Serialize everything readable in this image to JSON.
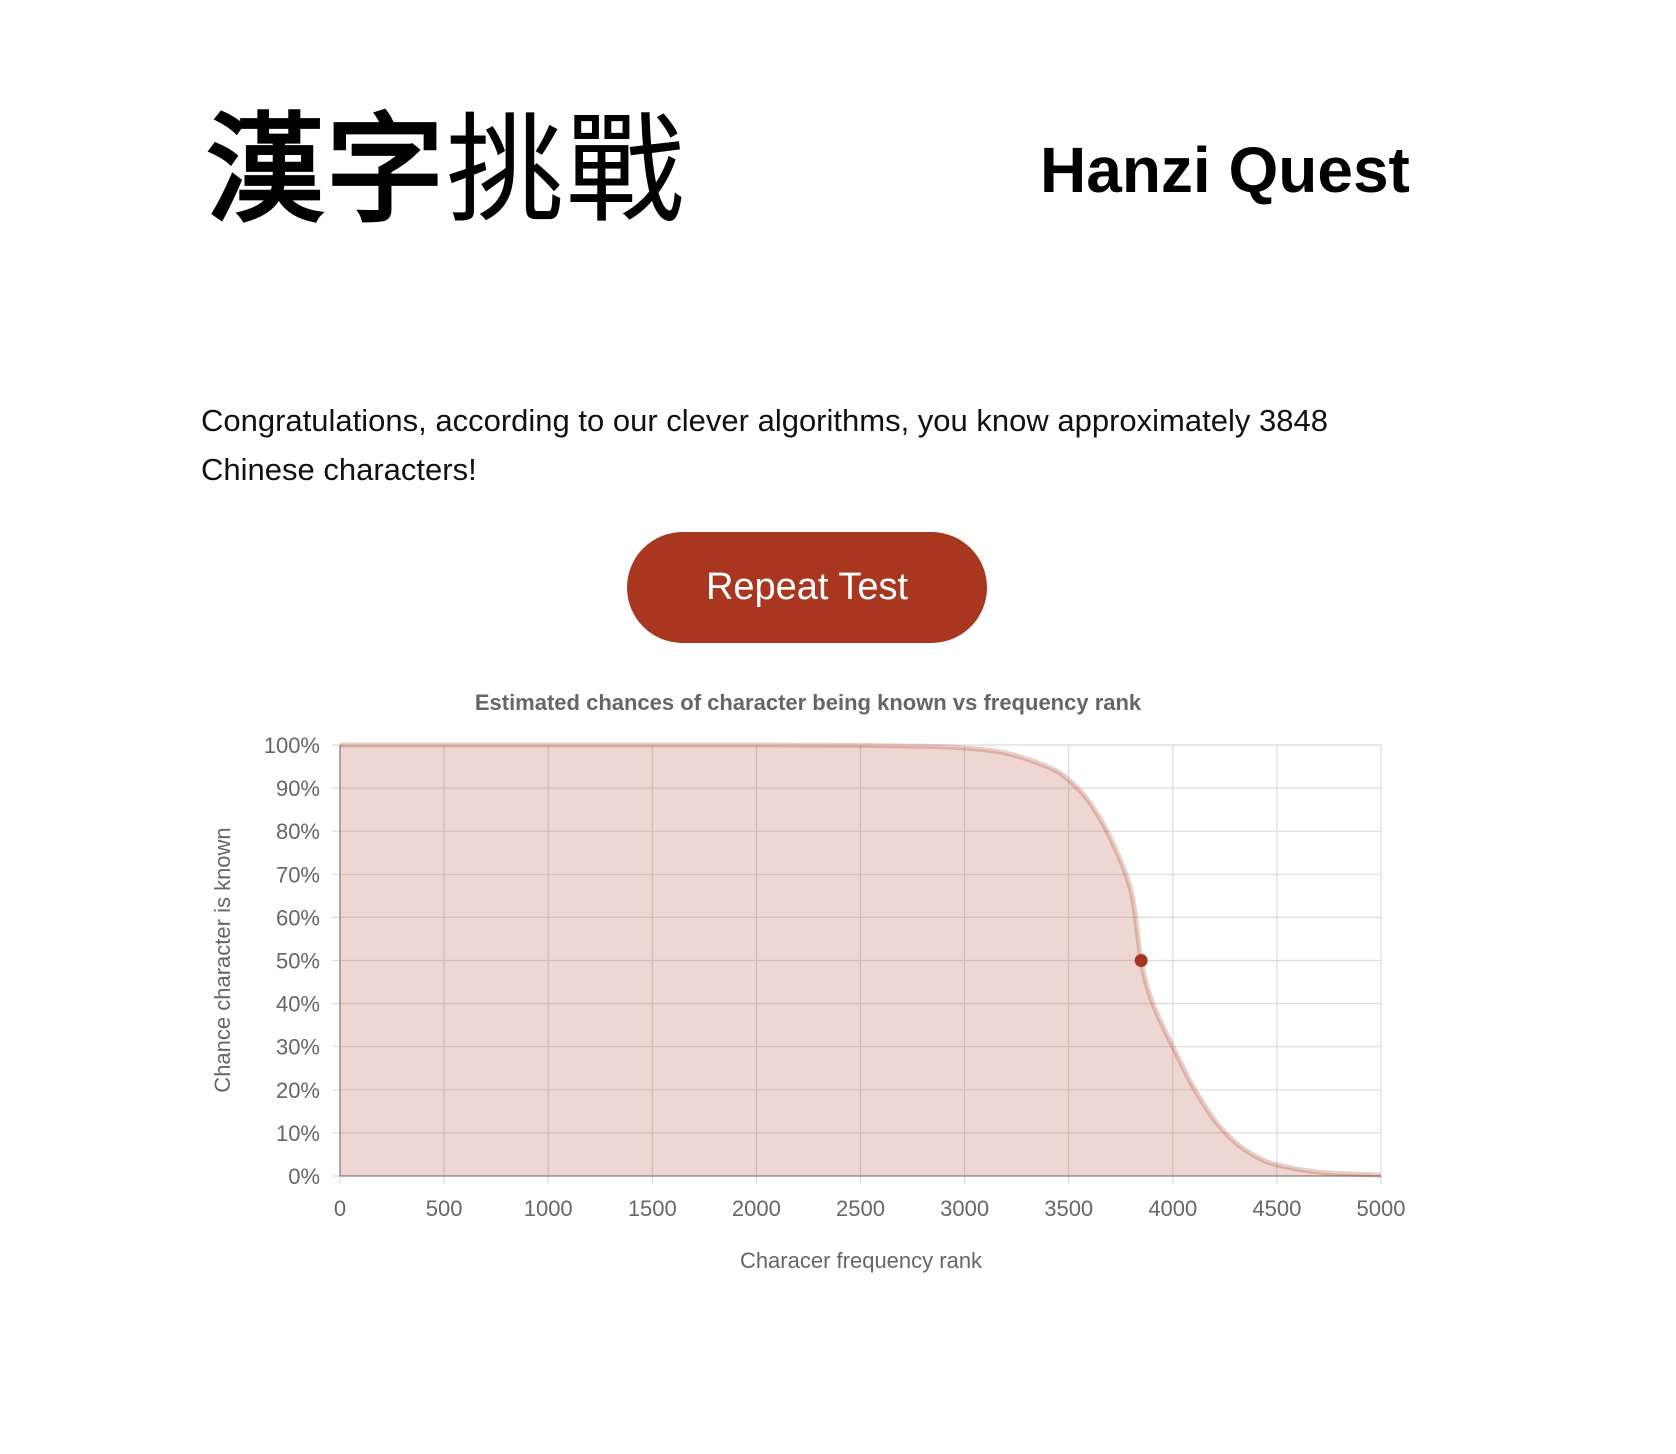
{
  "header": {
    "logo_chars": [
      "漢",
      "字",
      "挑",
      "戰"
    ],
    "site_title": "Hanzi Quest"
  },
  "result": {
    "message": "Congratulations, according to our clever algorithms, you know approximately 3848 Chinese characters!"
  },
  "actions": {
    "repeat_label": "Repeat Test"
  },
  "colors": {
    "accent": "#a93720",
    "fill": "rgba(169,55,32,0.2)",
    "line": "rgba(169,55,32,0.25)",
    "grid": "#dcdcdc",
    "tick_text": "#666666"
  },
  "chart_data": {
    "type": "area",
    "title": "Estimated chances of character being known vs frequency rank",
    "xlabel": "Characer frequency rank",
    "ylabel": "Chance character is known",
    "xlim": [
      0,
      5000
    ],
    "ylim": [
      0,
      100
    ],
    "x_ticks": [
      "0",
      "500",
      "1000",
      "1500",
      "2000",
      "2500",
      "3000",
      "3500",
      "4000",
      "4500",
      "5000"
    ],
    "y_ticks": [
      "0%",
      "10%",
      "20%",
      "30%",
      "40%",
      "50%",
      "60%",
      "70%",
      "80%",
      "90%",
      "100%"
    ],
    "grid": true,
    "legend": "none",
    "series": [
      {
        "x": [
          0,
          500,
          1000,
          1500,
          2000,
          2500,
          2800,
          3000,
          3200,
          3400,
          3500,
          3600,
          3700,
          3800,
          3848,
          3900,
          4000,
          4100,
          4200,
          4300,
          4400,
          4500,
          4700,
          5000
        ],
        "y": [
          100,
          100,
          100,
          100,
          100,
          99.9,
          99.7,
          99.3,
          98.1,
          94.9,
          91.9,
          86.7,
          78.4,
          66.0,
          50,
          40.5,
          30.0,
          20.5,
          13.0,
          7.8,
          4.5,
          2.6,
          0.9,
          0.2
        ]
      }
    ],
    "marker": {
      "x": 3848,
      "y": 50
    }
  }
}
